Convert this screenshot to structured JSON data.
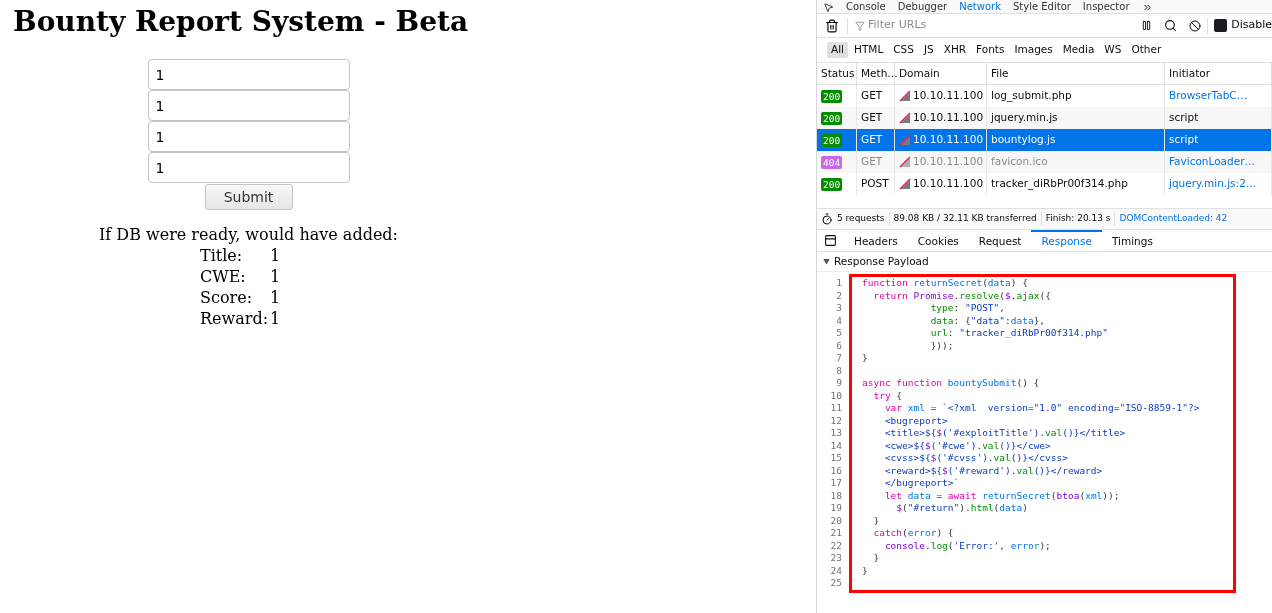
{
  "page": {
    "title": "Bounty Report System - Beta",
    "fields": [
      {
        "value": "1"
      },
      {
        "value": "1"
      },
      {
        "value": "1"
      },
      {
        "value": "1"
      }
    ],
    "submit": "Submit",
    "result": {
      "heading": "If DB were ready, would have added:",
      "rows": [
        {
          "label": "Title:",
          "value": "1"
        },
        {
          "label": "CWE:",
          "value": "1"
        },
        {
          "label": "Score:",
          "value": "1"
        },
        {
          "label": "Reward:",
          "value": "1"
        }
      ]
    }
  },
  "devtools": {
    "tabs": [
      {
        "label": "Console",
        "selected": false
      },
      {
        "label": "Debugger",
        "selected": false
      },
      {
        "label": "Network",
        "selected": true
      },
      {
        "label": "Style Editor",
        "selected": false
      },
      {
        "label": "Inspector",
        "selected": false
      }
    ],
    "filter_placeholder": "Filter URLs",
    "disable_cache": {
      "label": "Disable",
      "checked": true
    },
    "type_filters": [
      {
        "label": "All",
        "selected": true
      },
      {
        "label": "HTML",
        "selected": false
      },
      {
        "label": "CSS",
        "selected": false
      },
      {
        "label": "JS",
        "selected": false
      },
      {
        "label": "XHR",
        "selected": false
      },
      {
        "label": "Fonts",
        "selected": false
      },
      {
        "label": "Images",
        "selected": false
      },
      {
        "label": "Media",
        "selected": false
      },
      {
        "label": "WS",
        "selected": false
      },
      {
        "label": "Other",
        "selected": false
      }
    ],
    "columns": [
      "Status",
      "Meth…",
      "Domain",
      "File",
      "Initiator"
    ],
    "requests": [
      {
        "status": "200",
        "color": "#058b00",
        "method": "GET",
        "domain": "10.10.11.100",
        "file": "log_submit.php",
        "initiator": "BrowserTabC…",
        "initiator_link": true,
        "selected": false,
        "dimmed": false
      },
      {
        "status": "200",
        "color": "#058b00",
        "method": "GET",
        "domain": "10.10.11.100",
        "file": "jquery.min.js",
        "initiator": "script",
        "initiator_link": false,
        "selected": false,
        "dimmed": false
      },
      {
        "status": "200",
        "color": "#058b00",
        "method": "GET",
        "domain": "10.10.11.100",
        "file": "bountylog.js",
        "initiator": "script",
        "initiator_link": false,
        "selected": true,
        "dimmed": false
      },
      {
        "status": "404",
        "color": "#c968e8",
        "method": "GET",
        "domain": "10.10.11.100",
        "file": "favicon.ico",
        "initiator": "FaviconLoader…",
        "initiator_link": true,
        "selected": false,
        "dimmed": true
      },
      {
        "status": "200",
        "color": "#058b00",
        "method": "POST",
        "domain": "10.10.11.100",
        "file": "tracker_diRbPr00f314.php",
        "initiator": "jquery.min.js:2…",
        "initiator_link": true,
        "selected": false,
        "dimmed": false
      }
    ],
    "summary": {
      "requests": "5 requests",
      "transferred": "89.08 KB / 32.11 KB transferred",
      "finish": "Finish: 20.13 s",
      "dom_loaded": "DOMContentLoaded: 42"
    },
    "detail_tabs": [
      {
        "label": "Headers",
        "selected": false
      },
      {
        "label": "Cookies",
        "selected": false
      },
      {
        "label": "Request",
        "selected": false
      },
      {
        "label": "Response",
        "selected": true
      },
      {
        "label": "Timings",
        "selected": false
      }
    ],
    "section": {
      "label": "Response Payload",
      "expanded": true
    },
    "code": [
      {
        "num": "1",
        "tokens": [
          {
            "t": "function ",
            "kind": "kw"
          },
          {
            "t": "returnSecret",
            "kind": "def"
          },
          {
            "t": "(",
            "kind": "p"
          },
          {
            "t": "data",
            "kind": "def"
          },
          {
            "t": ") {",
            "kind": "p"
          }
        ]
      },
      {
        "num": "2",
        "tokens": [
          {
            "t": "  return ",
            "kind": "kw"
          },
          {
            "t": "Promise",
            "kind": "bi"
          },
          {
            "t": ".",
            "kind": "p"
          },
          {
            "t": "resolve",
            "kind": "prop"
          },
          {
            "t": "(",
            "kind": "p"
          },
          {
            "t": "$",
            "kind": "bi"
          },
          {
            "t": ".",
            "kind": "p"
          },
          {
            "t": "ajax",
            "kind": "prop"
          },
          {
            "t": "({",
            "kind": "p"
          }
        ]
      },
      {
        "num": "3",
        "tokens": [
          {
            "t": "            type",
            "kind": "prop"
          },
          {
            "t": ": ",
            "kind": "p"
          },
          {
            "t": "\"POST\"",
            "kind": "str"
          },
          {
            "t": ",",
            "kind": "p"
          }
        ]
      },
      {
        "num": "4",
        "tokens": [
          {
            "t": "            data",
            "kind": "prop"
          },
          {
            "t": ": {",
            "kind": "p"
          },
          {
            "t": "\"data\"",
            "kind": "str"
          },
          {
            "t": ":",
            "kind": "p"
          },
          {
            "t": "data",
            "kind": "def"
          },
          {
            "t": "},",
            "kind": "p"
          }
        ]
      },
      {
        "num": "5",
        "tokens": [
          {
            "t": "            url",
            "kind": "prop"
          },
          {
            "t": ": ",
            "kind": "p"
          },
          {
            "t": "\"tracker_diRbPr00f314.php\"",
            "kind": "str"
          }
        ]
      },
      {
        "num": "6",
        "tokens": [
          {
            "t": "            }));",
            "kind": "p"
          }
        ]
      },
      {
        "num": "7",
        "tokens": [
          {
            "t": "}",
            "kind": "p"
          }
        ]
      },
      {
        "num": "8"
      },
      {
        "num": "9",
        "tokens": [
          {
            "t": "async function ",
            "kind": "kw"
          },
          {
            "t": "bountySubmit",
            "kind": "def"
          },
          {
            "t": "() {",
            "kind": "p"
          }
        ]
      },
      {
        "num": "10",
        "tokens": [
          {
            "t": "  try",
            "kind": "kw"
          },
          {
            "t": " {",
            "kind": "p"
          }
        ]
      },
      {
        "num": "11",
        "tokens": [
          {
            "t": "    var ",
            "kind": "kw"
          },
          {
            "t": "xml",
            "kind": "def"
          },
          {
            "t": " = ",
            "kind": "p"
          },
          {
            "t": "`<?xml  version=\"1.0\" encoding=\"ISO-8859-1\"?>",
            "kind": "str"
          }
        ]
      },
      {
        "num": "12",
        "tokens": [
          {
            "t": "    <bugreport>",
            "kind": "str"
          }
        ]
      },
      {
        "num": "13",
        "tokens": [
          {
            "t": "    <title>${",
            "kind": "str"
          },
          {
            "t": "$",
            "kind": "bi"
          },
          {
            "t": "('#exploitTitle').",
            "kind": "str"
          },
          {
            "t": "val",
            "kind": "prop"
          },
          {
            "t": "()}</title>",
            "kind": "str"
          }
        ]
      },
      {
        "num": "14",
        "tokens": [
          {
            "t": "    <cwe>${",
            "kind": "str"
          },
          {
            "t": "$",
            "kind": "bi"
          },
          {
            "t": "('#cwe').",
            "kind": "str"
          },
          {
            "t": "val",
            "kind": "prop"
          },
          {
            "t": "()}</cwe>",
            "kind": "str"
          }
        ]
      },
      {
        "num": "15",
        "tokens": [
          {
            "t": "    <cvss>${",
            "kind": "str"
          },
          {
            "t": "$",
            "kind": "bi"
          },
          {
            "t": "('#cvss').",
            "kind": "str"
          },
          {
            "t": "val",
            "kind": "prop"
          },
          {
            "t": "()}</cvss>",
            "kind": "str"
          }
        ]
      },
      {
        "num": "16",
        "tokens": [
          {
            "t": "    <reward>${",
            "kind": "str"
          },
          {
            "t": "$",
            "kind": "bi"
          },
          {
            "t": "('#reward').",
            "kind": "str"
          },
          {
            "t": "val",
            "kind": "prop"
          },
          {
            "t": "()}</reward>",
            "kind": "str"
          }
        ]
      },
      {
        "num": "17",
        "tokens": [
          {
            "t": "    </bugreport>`",
            "kind": "str"
          }
        ]
      },
      {
        "num": "18",
        "tokens": [
          {
            "t": "    let ",
            "kind": "kw"
          },
          {
            "t": "data",
            "kind": "def"
          },
          {
            "t": " = ",
            "kind": "p"
          },
          {
            "t": "await ",
            "kind": "kw"
          },
          {
            "t": "returnSecret",
            "kind": "def"
          },
          {
            "t": "(",
            "kind": "p"
          },
          {
            "t": "btoa",
            "kind": "bi"
          },
          {
            "t": "(",
            "kind": "p"
          },
          {
            "t": "xml",
            "kind": "def"
          },
          {
            "t": "));",
            "kind": "p"
          }
        ]
      },
      {
        "num": "19",
        "tokens": [
          {
            "t": "      $",
            "kind": "bi"
          },
          {
            "t": "(",
            "kind": "p"
          },
          {
            "t": "\"#return\"",
            "kind": "str"
          },
          {
            "t": ").",
            "kind": "p"
          },
          {
            "t": "html",
            "kind": "prop"
          },
          {
            "t": "(",
            "kind": "p"
          },
          {
            "t": "data",
            "kind": "def"
          },
          {
            "t": ")",
            "kind": "p"
          }
        ]
      },
      {
        "num": "20",
        "tokens": [
          {
            "t": "  }",
            "kind": "p"
          }
        ]
      },
      {
        "num": "21",
        "tokens": [
          {
            "t": "  catch",
            "kind": "kw"
          },
          {
            "t": "(",
            "kind": "p"
          },
          {
            "t": "error",
            "kind": "def"
          },
          {
            "t": ") {",
            "kind": "p"
          }
        ]
      },
      {
        "num": "22",
        "tokens": [
          {
            "t": "    console",
            "kind": "bi"
          },
          {
            "t": ".",
            "kind": "p"
          },
          {
            "t": "log",
            "kind": "prop"
          },
          {
            "t": "(",
            "kind": "p"
          },
          {
            "t": "'Error:'",
            "kind": "str"
          },
          {
            "t": ", ",
            "kind": "p"
          },
          {
            "t": "error",
            "kind": "def"
          },
          {
            "t": ");",
            "kind": "p"
          }
        ]
      },
      {
        "num": "23",
        "tokens": [
          {
            "t": "  }",
            "kind": "p"
          }
        ]
      },
      {
        "num": "24",
        "tokens": [
          {
            "t": "}",
            "kind": "p"
          }
        ]
      },
      {
        "num": "25"
      }
    ]
  }
}
